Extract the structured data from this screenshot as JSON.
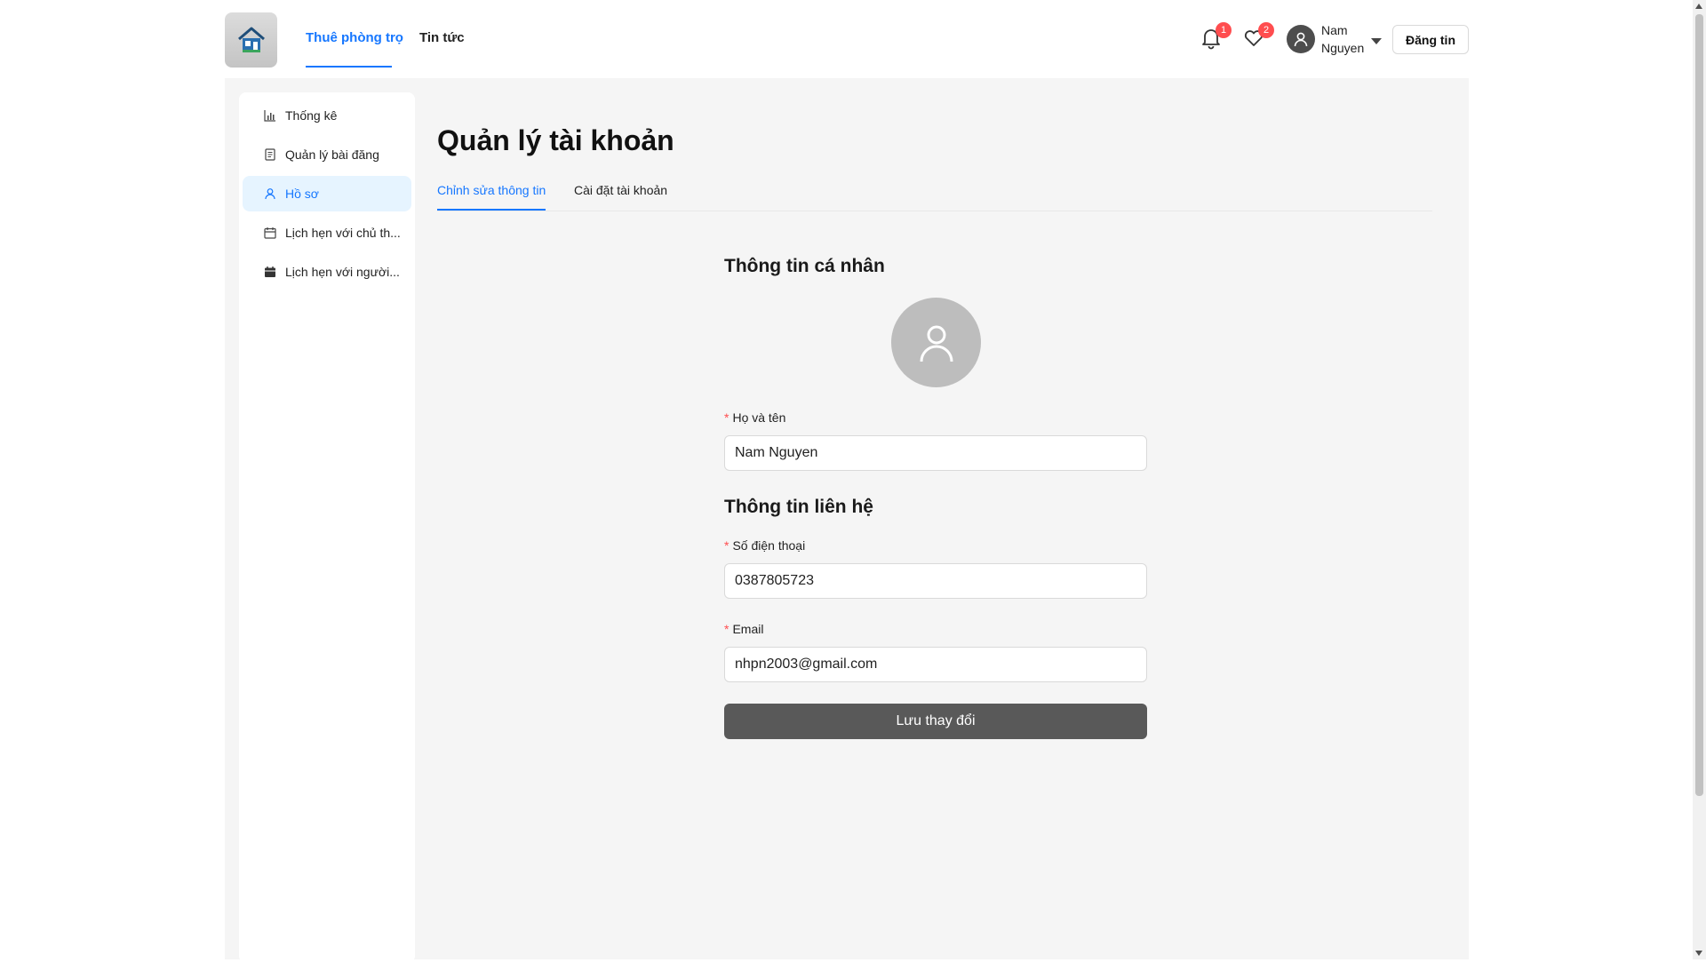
{
  "header": {
    "logo": "house-logo",
    "nav": [
      {
        "label": "Thuê phòng trọ",
        "active": true
      },
      {
        "label": "Tin tức",
        "active": false
      }
    ],
    "notifications": {
      "icon": "bell-icon",
      "count": "1"
    },
    "favorites": {
      "icon": "heart-icon",
      "count": "2"
    },
    "user": {
      "name": "Nam Nguyen",
      "icon": "user-icon"
    },
    "post_button": "Đăng tin"
  },
  "sidebar": {
    "items": [
      {
        "label": "Thống kê",
        "icon": "bar-chart-icon",
        "active": false
      },
      {
        "label": "Quản lý bài đăng",
        "icon": "document-icon",
        "active": false
      },
      {
        "label": "Hồ sơ",
        "icon": "user-icon",
        "active": true
      },
      {
        "label": "Lịch hẹn với chủ th...",
        "icon": "calendar-icon",
        "active": false
      },
      {
        "label": "Lịch hẹn với người...",
        "icon": "calendar-filled-icon",
        "active": false
      }
    ]
  },
  "page": {
    "title": "Quản lý tài khoản",
    "tabs": [
      {
        "label": "Chỉnh sửa thông tin",
        "active": true
      },
      {
        "label": "Cài đặt tài khoản",
        "active": false
      }
    ]
  },
  "form": {
    "personal_title": "Thông tin cá nhân",
    "name_label": "Họ và tên",
    "name_value": "Nam Nguyen",
    "contact_title": "Thông tin liên hệ",
    "phone_label": "Số điện thoại",
    "phone_value": "0387805723",
    "email_label": "Email",
    "email_value": "nhpn2003@gmail.com",
    "save_button": "Lưu thay đổi"
  },
  "colors": {
    "accent": "#1677ff",
    "badge": "#ff4d4f",
    "save_button": "#595959",
    "background": "#f5f5f5"
  }
}
